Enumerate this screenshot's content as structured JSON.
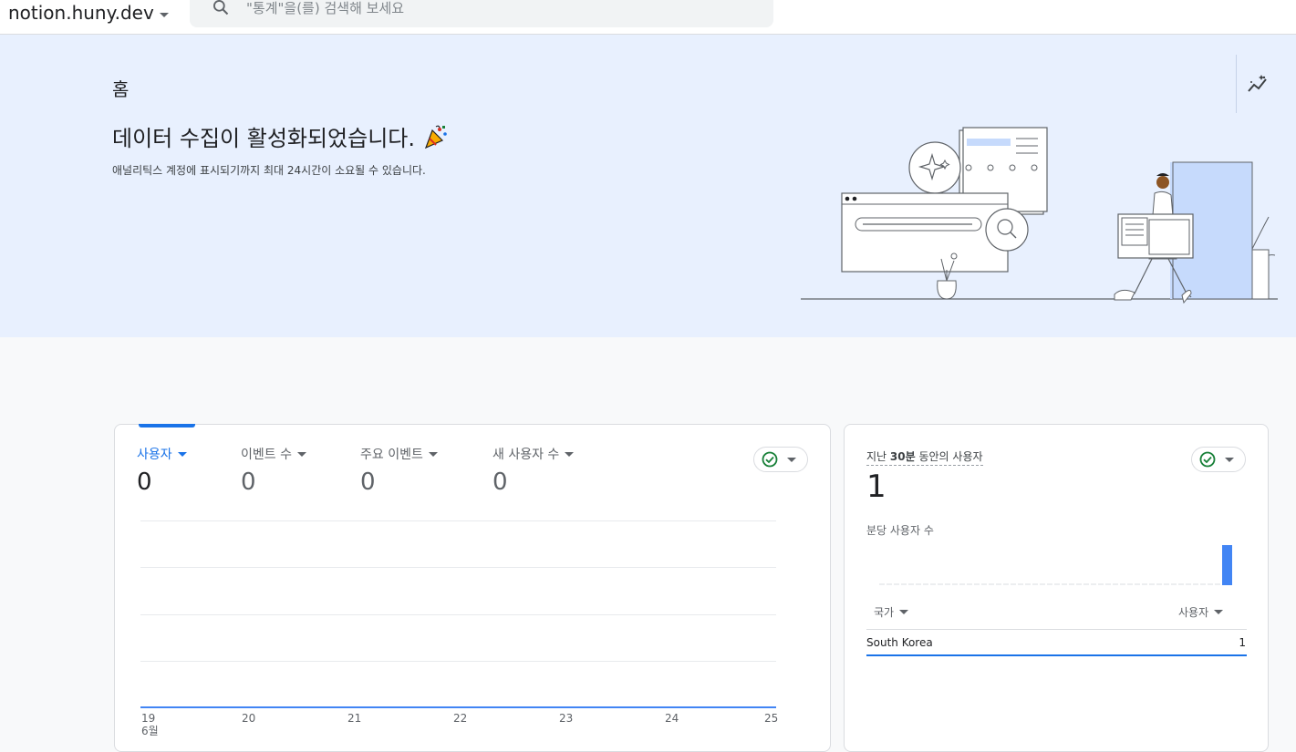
{
  "header": {
    "property_name": "notion.huny.dev",
    "search_placeholder": "\"통계\"을(를) 검색해 보세요"
  },
  "hero": {
    "home_label": "홈",
    "title": "데이터 수집이 활성화되었습니다.",
    "subtitle": "애널리틱스 계정에 표시되기까지 최대 24시간이 소요될 수 있습니다.",
    "emoji": "🎉"
  },
  "overview": {
    "metrics": [
      {
        "label": "사용자",
        "value": "0"
      },
      {
        "label": "이벤트 수",
        "value": "0"
      },
      {
        "label": "주요 이벤트",
        "value": "0"
      },
      {
        "label": "새 사용자 수",
        "value": "0"
      }
    ],
    "x_ticks": [
      "19",
      "20",
      "21",
      "22",
      "23",
      "24",
      "25"
    ],
    "x_month": "6월"
  },
  "realtime": {
    "title_prefix": "지난 ",
    "title_bold": "30분",
    "title_suffix": " 동안의 사용자",
    "value": "1",
    "per_minute_label": "분당 사용자 수",
    "col_country": "국가",
    "col_users": "사용자",
    "rows": [
      {
        "country": "South Korea",
        "users": "1"
      }
    ]
  },
  "colors": {
    "accent": "#1a73e8",
    "hero_bg": "#e8f0fe",
    "status_ok": "#188038"
  }
}
